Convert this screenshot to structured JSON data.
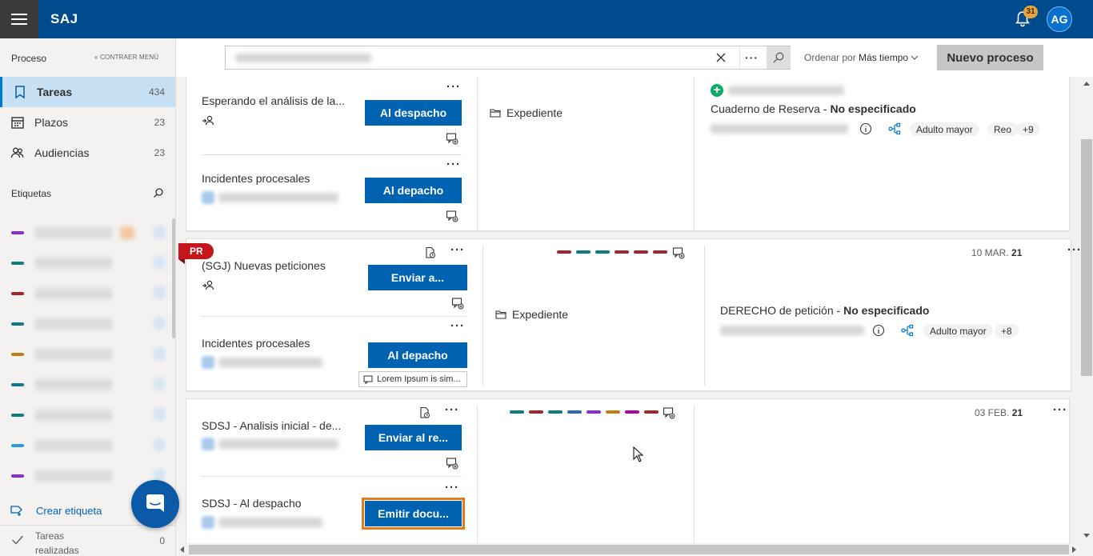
{
  "app": {
    "brand": "SAJ",
    "notifications_count": "31",
    "user_initials": "AG"
  },
  "sidebar": {
    "section_title": "Proceso",
    "collapse_label": "« CONTRAER MENÚ",
    "nav": [
      {
        "label": "Tareas",
        "count": "434",
        "icon": "bookmark-icon"
      },
      {
        "label": "Plazos",
        "count": "23",
        "icon": "calendar-icon"
      },
      {
        "label": "Audiencias",
        "count": "23",
        "icon": "people-icon"
      }
    ],
    "tags_title": "Etiquetas",
    "tag_colors": [
      "#8a2bd6",
      "#0e7c86",
      "#a4262c",
      "#0e7c86",
      "#c17c12",
      "#0e7c86",
      "#0e7c86",
      "#2b9be0",
      "#8a2bd6"
    ],
    "create_tag_label": "Crear etiqueta",
    "done_label": "Tareas realizadas",
    "done_count": "0"
  },
  "toolbar": {
    "search_placeholder": "",
    "sort_prefix": "Ordenar por",
    "sort_value": "Más tiempo",
    "new_process_label": "Nuevo proceso"
  },
  "cards": [
    {
      "tasks": [
        {
          "title": "Esperando el análisis de la...",
          "action": "Al despacho"
        },
        {
          "title": "Incidentes procesales",
          "action": "Al depacho"
        }
      ],
      "expediente_label": "Expediente",
      "case_title": "Cuaderno de Reserva",
      "case_status": "No especificado",
      "chips": [
        "Adulto mayor",
        "Reo",
        "+9"
      ]
    },
    {
      "flag": "PR",
      "date_prefix": "10 MAR.",
      "date_day": "21",
      "tasks": [
        {
          "title": "(SGJ) Nuevas peticiones",
          "action": "Enviar a..."
        },
        {
          "title": "Incidentes procesales",
          "action": "Al depacho"
        }
      ],
      "comment": "Lorem Ipsum is sim...",
      "expediente_label": "Expediente",
      "case_title": "DERECHO de petición",
      "case_status": "No especificado",
      "chips": [
        "Adulto mayor",
        "+8"
      ],
      "colors": [
        "#a4262c",
        "#0e7c86",
        "#0e7c86",
        "#a4262c",
        "#a4262c",
        "#a4262c"
      ]
    },
    {
      "date_prefix": "03 FEB.",
      "date_day": "21",
      "tasks": [
        {
          "title": "SDSJ - Analisis inicial - de...",
          "action": "Enviar al re..."
        },
        {
          "title": "SDSJ - Al despacho",
          "action": "Emitir docu..."
        }
      ],
      "colors": [
        "#0e7c86",
        "#a4262c",
        "#0e7c86",
        "#2b6cb0",
        "#8a2bd6",
        "#c17c12",
        "#b4009e",
        "#a4262c"
      ]
    }
  ]
}
